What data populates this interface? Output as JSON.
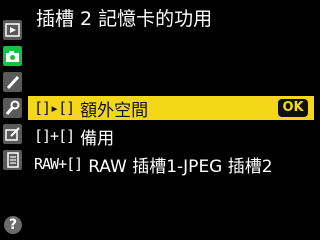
{
  "header": {
    "title": "插槽 2 記憶卡的功用"
  },
  "rail": {
    "tabs": [
      {
        "name": "playback-icon",
        "active": false
      },
      {
        "name": "camera-icon",
        "active": true
      },
      {
        "name": "pencil-icon",
        "active": false
      },
      {
        "name": "wrench-icon",
        "active": false
      },
      {
        "name": "retouch-icon",
        "active": false
      },
      {
        "name": "recent-settings-icon",
        "active": false
      }
    ],
    "help_label": "?"
  },
  "menu": {
    "items": [
      {
        "icon": "[]▸[]",
        "label": "額外空間",
        "selected": true
      },
      {
        "icon": "[]+[]",
        "label": "備用",
        "selected": false
      },
      {
        "icon": "RAW+[]",
        "label": "RAW 插槽1-JPEG 插槽2",
        "selected": false
      }
    ],
    "ok_label": "OK"
  },
  "colors": {
    "accent": "#f4d719",
    "active_tab": "#17c23e",
    "background": "#000000"
  }
}
